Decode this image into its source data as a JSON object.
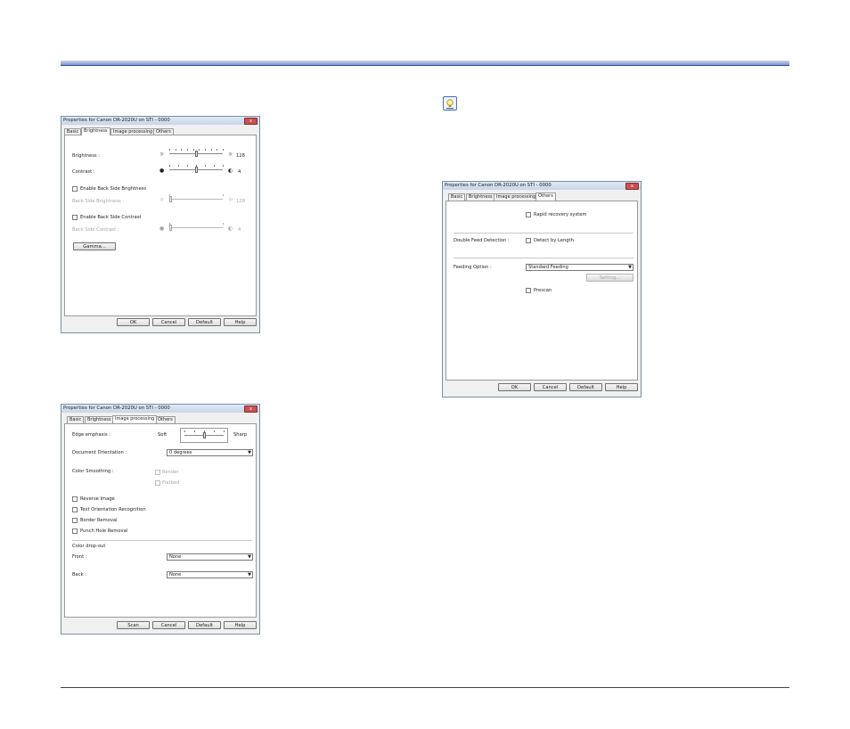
{
  "page": {
    "note_icon": "lightbulb-tip-icon"
  },
  "dlg1": {
    "title": "Properties for Canon DR-2020U on STI - 0000",
    "close": "x",
    "tabs": [
      "Basic",
      "Brightness",
      "Image processing",
      "Others"
    ],
    "active_tab": "Brightness",
    "brightness": {
      "label": "Brightness :",
      "value": "128",
      "level": 0.5
    },
    "contrast": {
      "label": "Contrast :",
      "value": "4",
      "level": 0.5
    },
    "enable_back_brightness": "Enable Back Side Brightness",
    "back_brightness": {
      "label": "Back Side Brightness :",
      "value": "128",
      "level": 0.0
    },
    "enable_back_contrast": "Enable Back Side Contrast",
    "back_contrast": {
      "label": "Back Side Contrast :",
      "value": "4",
      "level": 0.0
    },
    "gamma_button": "Gamma...",
    "buttons": {
      "ok": "OK",
      "cancel": "Cancel",
      "default": "Default",
      "help": "Help"
    }
  },
  "dlg2": {
    "title": "Properties for Canon DR-2020U on STI - 0000",
    "close": "x",
    "tabs": [
      "Basic",
      "Brightness",
      "Image processing",
      "Others"
    ],
    "active_tab": "Image processing",
    "edge_emphasis": {
      "label": "Edge emphasis :",
      "soft": "Soft",
      "sharp": "Sharp",
      "level": 0.5
    },
    "document_orientation": {
      "label": "Document Orientation :",
      "value": "0 degrees"
    },
    "color_smoothing": {
      "label": "Color Smoothing :",
      "options": [
        "Render",
        "Flatbed"
      ]
    },
    "checkboxes": [
      "Reverse Image",
      "Text Orientation Recognition",
      "Border Removal",
      "Punch Hole Removal"
    ],
    "color_dropout": {
      "label": "Color drop-out",
      "front_label": "Front :",
      "front_value": "None",
      "back_label": "Back :",
      "back_value": "None"
    },
    "buttons": {
      "scan": "Scan",
      "cancel": "Cancel",
      "default": "Default",
      "help": "Help"
    }
  },
  "dlg3": {
    "title": "Properties for Canon DR-2020U on STI - 0000",
    "close": "x",
    "tabs": [
      "Basic",
      "Brightness",
      "Image processing",
      "Others"
    ],
    "active_tab": "Others",
    "rapid_recovery": "Rapid recovery system",
    "double_feed": {
      "label": "Double Feed Detection :",
      "option": "Detect by Length"
    },
    "feeding_option": {
      "label": "Feeding Option :",
      "value": "Standard Feeding",
      "setting_button": "Setting..."
    },
    "prescan": "Prescan",
    "buttons": {
      "ok": "OK",
      "cancel": "Cancel",
      "default": "Default",
      "help": "Help"
    }
  }
}
